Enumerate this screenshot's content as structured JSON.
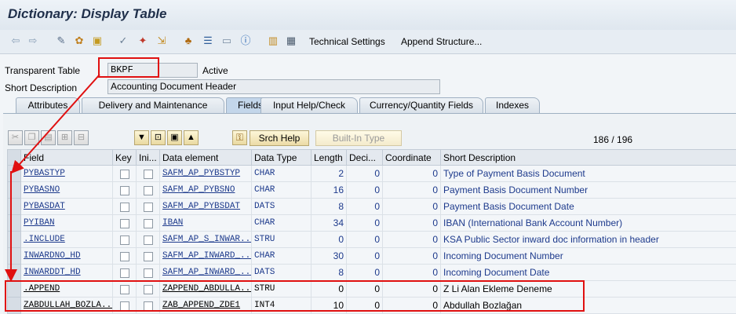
{
  "window": {
    "title": "Dictionary: Display Table"
  },
  "toolbar": {
    "technical_settings": "Technical Settings",
    "append_structure": "Append Structure..."
  },
  "header": {
    "table_label": "Transparent Table",
    "table_value": "BKPF",
    "status": "Active",
    "short_desc_label": "Short Description",
    "short_desc_value": "Accounting Document Header"
  },
  "tabs": [
    {
      "label": "Attributes"
    },
    {
      "label": "Delivery and Maintenance"
    },
    {
      "label": "Fields",
      "active": true
    },
    {
      "label": "Input Help/Check"
    },
    {
      "label": "Currency/Quantity Fields"
    },
    {
      "label": "Indexes"
    }
  ],
  "fields_toolbar": {
    "srch_help": "Srch Help",
    "built_in_type": "Built-In Type",
    "counter": "186  /  196"
  },
  "grid": {
    "columns": [
      "Field",
      "Key",
      "Ini...",
      "Data element",
      "Data Type",
      "Length",
      "Deci...",
      "Coordinate",
      "Short Description"
    ],
    "rows": [
      {
        "field": "PYBASTYP",
        "data_element": "SAFM_AP_PYBSTYP",
        "data_type": "CHAR",
        "length": "2",
        "decimals": "0",
        "coordinate": "0",
        "description": "Type of Payment Basis Document"
      },
      {
        "field": "PYBASNO",
        "data_element": "SAFM_AP_PYBSNO",
        "data_type": "CHAR",
        "length": "16",
        "decimals": "0",
        "coordinate": "0",
        "description": "Payment Basis Document Number"
      },
      {
        "field": "PYBASDAT",
        "data_element": "SAFM_AP_PYBSDAT",
        "data_type": "DATS",
        "length": "8",
        "decimals": "0",
        "coordinate": "0",
        "description": "Payment Basis Document Date"
      },
      {
        "field": "PYIBAN",
        "data_element": "IBAN",
        "data_type": "CHAR",
        "length": "34",
        "decimals": "0",
        "coordinate": "0",
        "description": "IBAN (International Bank Account Number)"
      },
      {
        "field": ".INCLUDE",
        "data_element": "SAFM_AP_S_INWAR...",
        "data_type": "STRU",
        "length": "0",
        "decimals": "0",
        "coordinate": "0",
        "description": "KSA Public Sector inward doc information in header"
      },
      {
        "field": "INWARDNO_HD",
        "data_element": "SAFM_AP_INWARD_...",
        "data_type": "CHAR",
        "length": "30",
        "decimals": "0",
        "coordinate": "0",
        "description": "Incoming Document Number"
      },
      {
        "field": "INWARDDT_HD",
        "data_element": "SAFM_AP_INWARD_...",
        "data_type": "DATS",
        "length": "8",
        "decimals": "0",
        "coordinate": "0",
        "description": "Incoming Document Date"
      },
      {
        "field": ".APPEND",
        "data_element": "ZAPPEND_ABDULLA...",
        "data_type": "STRU",
        "length": "0",
        "decimals": "0",
        "coordinate": "0",
        "description": "Z Li Alan Ekleme Deneme",
        "plain": true
      },
      {
        "field": "ZABDULLAH_BOZLA...",
        "data_element": "ZAB_APPEND_ZDE1",
        "data_type": "INT4",
        "length": "10",
        "decimals": "0",
        "coordinate": "0",
        "description": "Abdullah Bozlağan",
        "plain": true
      }
    ]
  },
  "colors": {
    "highlight": "#e01010",
    "link": "#1d3a8c"
  }
}
